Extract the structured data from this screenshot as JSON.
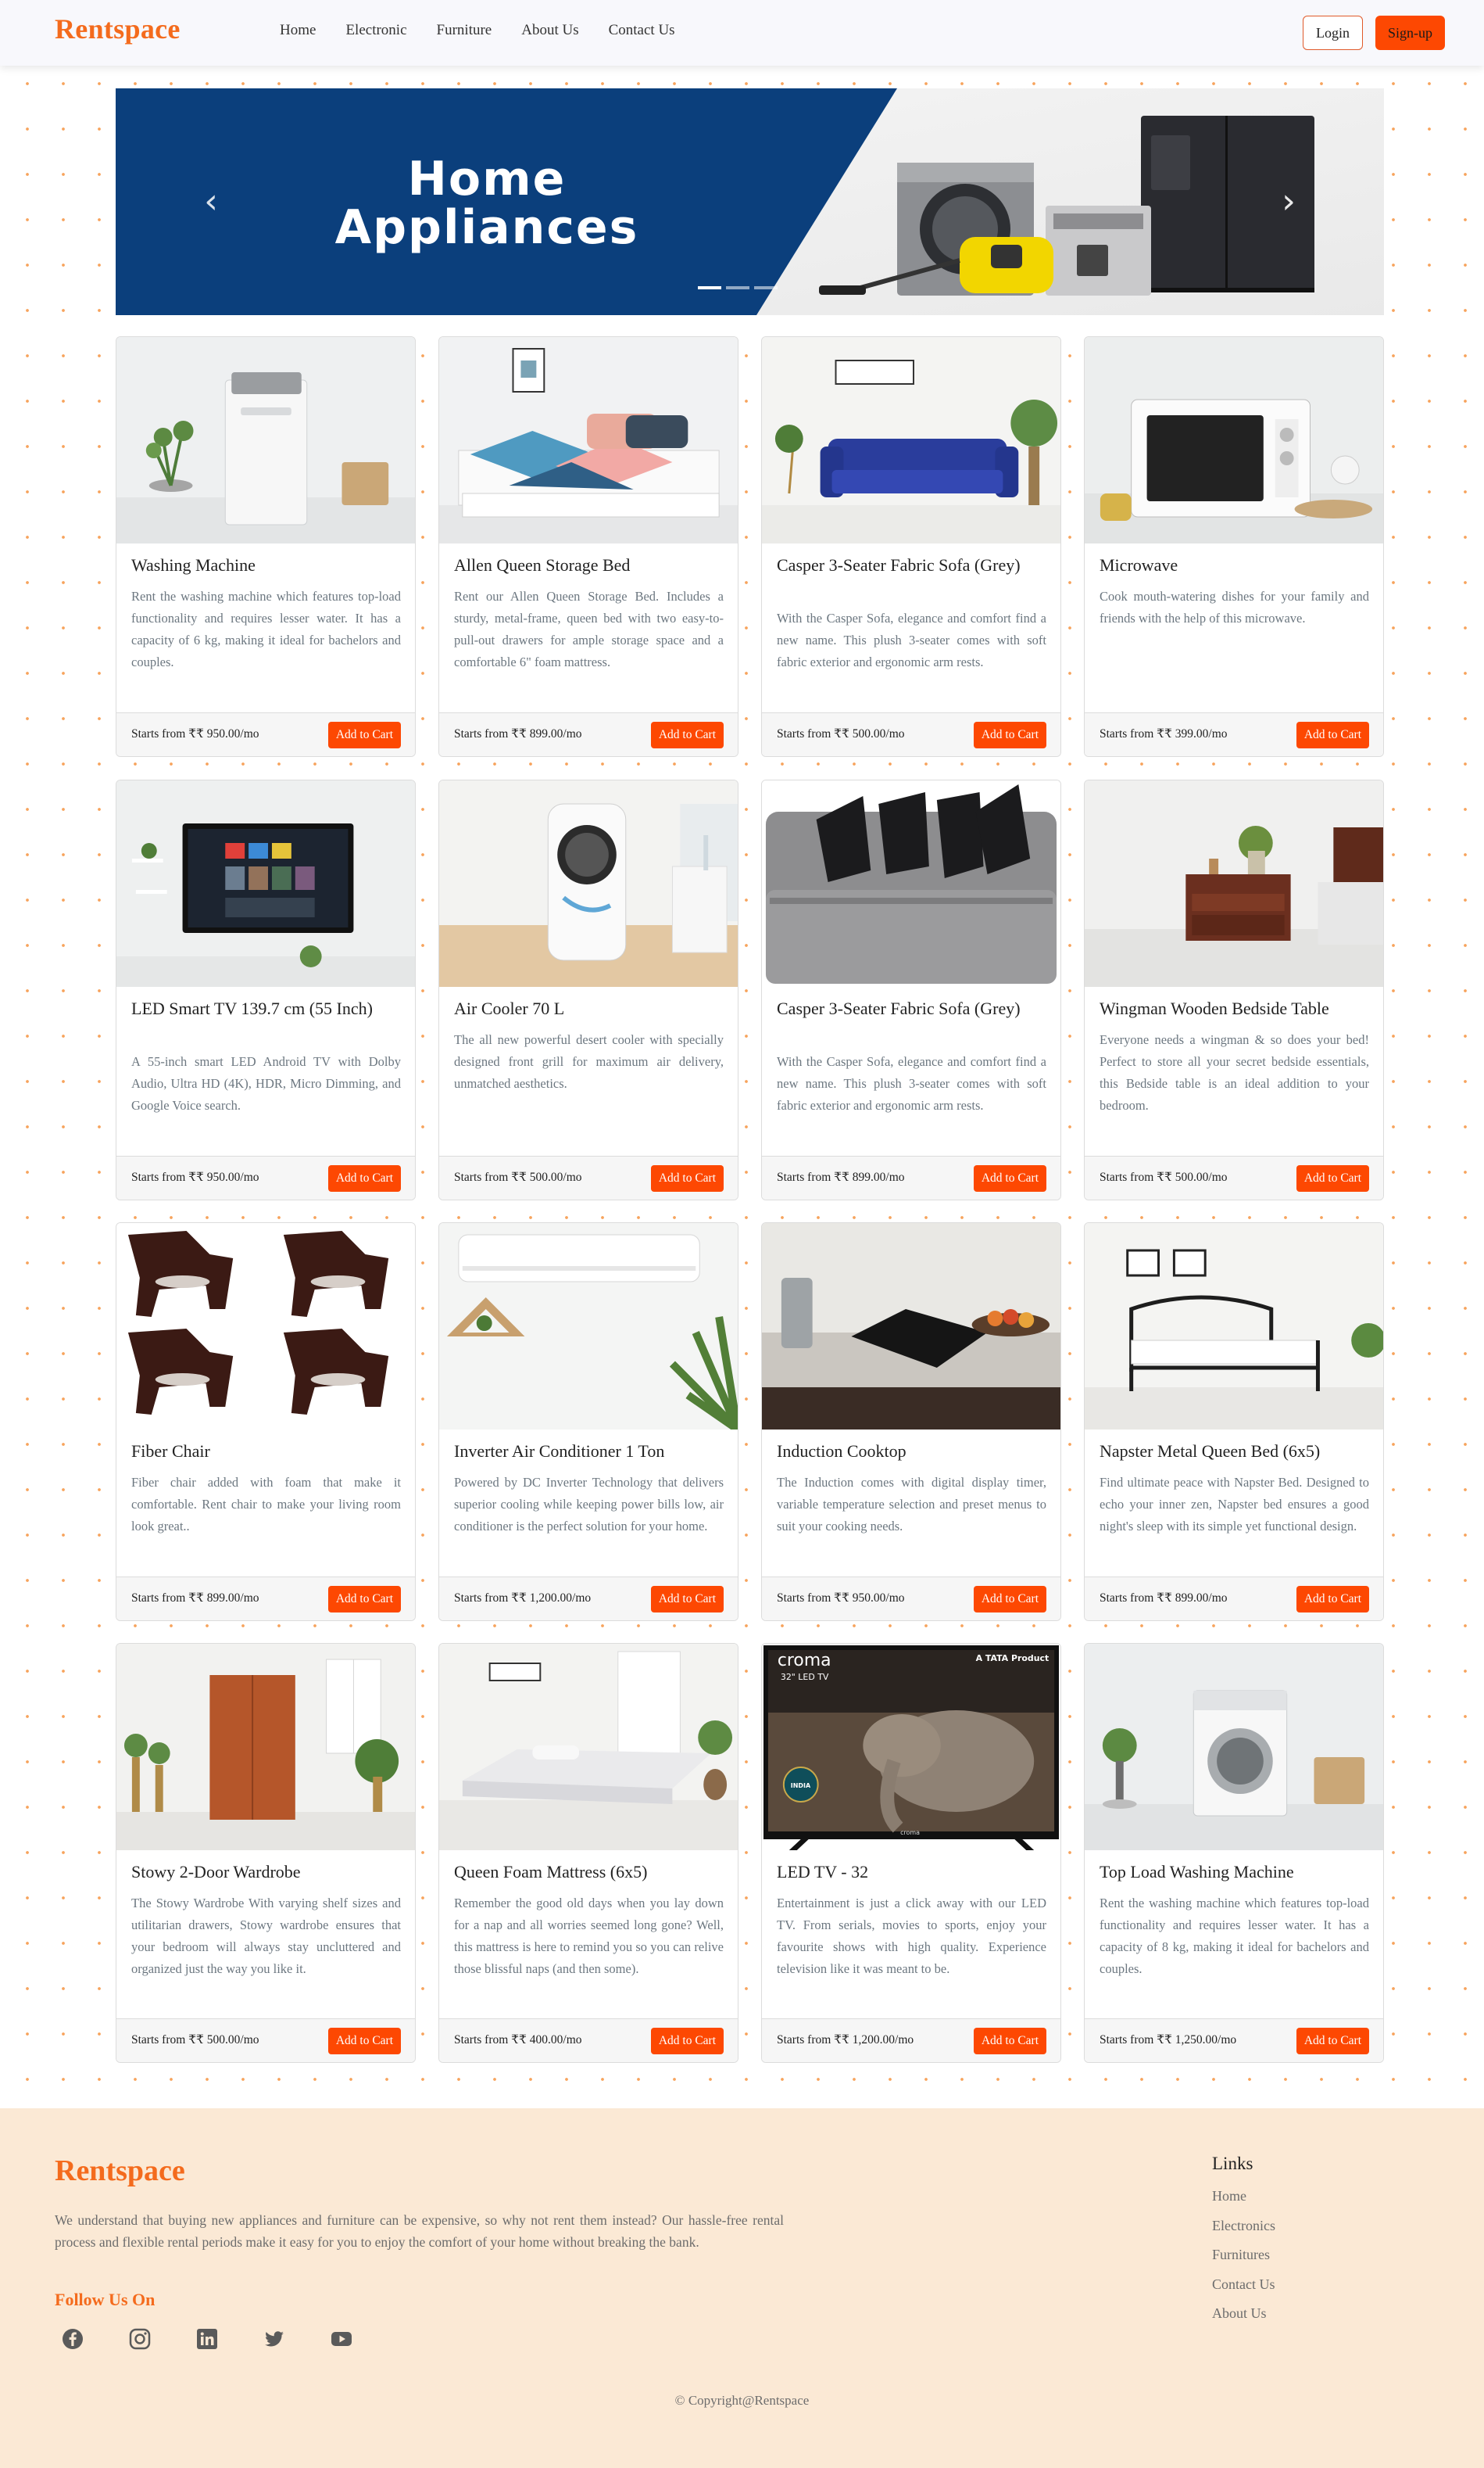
{
  "brand": "Rentspace",
  "nav": {
    "links": [
      "Home",
      "Electronic",
      "Furniture",
      "About Us",
      "Contact Us"
    ],
    "login": "Login",
    "signup": "Sign-up"
  },
  "carousel": {
    "title_line1": "Home",
    "title_line2": "Appliances",
    "prev": "‹",
    "next": "›",
    "slides": 3,
    "active_slide": 1
  },
  "products": [
    {
      "title": "Washing Machine",
      "desc": "Rent the washing machine which features top-load functionality and requires lesser water. It has a capacity of 6 kg, making it ideal for bachelors and couples.",
      "price": "Starts from ₹₹ 950.00/mo",
      "button": "Add to Cart",
      "image": "washing-machine"
    },
    {
      "title": "Allen Queen Storage Bed",
      "desc": "Rent our Allen Queen Storage Bed. Includes a sturdy, metal-frame, queen bed with two easy-to-pull-out drawers for ample storage space and a comfortable 6\" foam mattress.",
      "price": "Starts from ₹₹ 899.00/mo",
      "button": "Add to Cart",
      "image": "storage-bed"
    },
    {
      "title": "Casper 3-Seater Fabric Sofa (Grey)",
      "desc": "With the Casper Sofa, elegance and comfort find a new name. This plush 3-seater comes with soft fabric exterior and ergonomic arm rests.",
      "price": "Starts from ₹₹ 500.00/mo",
      "button": "Add to Cart",
      "image": "blue-sofa"
    },
    {
      "title": "Microwave",
      "desc": "Cook mouth-watering dishes for your family and friends with the help of this microwave.",
      "price": "Starts from ₹₹ 399.00/mo",
      "button": "Add to Cart",
      "image": "microwave"
    },
    {
      "title": "LED Smart TV 139.7 cm (55 Inch)",
      "desc": "A 55-inch smart LED Android TV with Dolby Audio, Ultra HD (4K), HDR, Micro Dimming, and Google Voice search.",
      "price": "Starts from ₹₹ 950.00/mo",
      "button": "Add to Cart",
      "image": "smart-tv"
    },
    {
      "title": "Air Cooler 70 L",
      "desc": "The all new powerful desert cooler with specially designed front grill for maximum air delivery, unmatched aesthetics.",
      "price": "Starts from ₹₹ 500.00/mo",
      "button": "Add to Cart",
      "image": "air-cooler"
    },
    {
      "title": "Casper 3-Seater Fabric Sofa (Grey)",
      "desc": "With the Casper Sofa, elegance and comfort find a new name. This plush 3-seater comes with soft fabric exterior and ergonomic arm rests.",
      "price": "Starts from ₹₹ 899.00/mo",
      "button": "Add to Cart",
      "image": "grey-sofa"
    },
    {
      "title": "Wingman Wooden Bedside Table",
      "desc": "Everyone needs a wingman & so does your bed! Perfect to store all your secret bedside essentials, this Bedside table is an ideal addition to your bedroom.",
      "price": "Starts from ₹₹ 500.00/mo",
      "button": "Add to Cart",
      "image": "bedside-table"
    },
    {
      "title": "Fiber Chair",
      "desc": "Fiber chair added with foam that make it comfortable. Rent chair to make your living room look great..",
      "price": "Starts from ₹₹ 899.00/mo",
      "button": "Add to Cart",
      "image": "fiber-chairs"
    },
    {
      "title": "Inverter Air Conditioner 1 Ton",
      "desc": "Powered by DC Inverter Technology that delivers superior cooling while keeping power bills low, air conditioner is the perfect solution for your home.",
      "price": "Starts from ₹₹ 1,200.00/mo",
      "button": "Add to Cart",
      "image": "air-conditioner"
    },
    {
      "title": "Induction Cooktop",
      "desc": "The Induction comes with digital display timer, variable temperature selection and preset menus to suit your cooking needs.",
      "price": "Starts from ₹₹ 950.00/mo",
      "button": "Add to Cart",
      "image": "induction-cooktop"
    },
    {
      "title": "Napster Metal Queen Bed (6x5)",
      "desc": "Find ultimate peace with Napster Bed. Designed to echo your inner zen, Napster bed ensures a good night's sleep with its simple yet functional design.",
      "price": "Starts from ₹₹ 899.00/mo",
      "button": "Add to Cart",
      "image": "metal-bed"
    },
    {
      "title": "Stowy 2-Door Wardrobe",
      "desc": "The Stowy Wardrobe With varying shelf sizes and utilitarian drawers, Stowy wardrobe ensures that your bedroom will always stay uncluttered and organized just the way you like it.",
      "price": "Starts from ₹₹ 500.00/mo",
      "button": "Add to Cart",
      "image": "wardrobe"
    },
    {
      "title": "Queen Foam Mattress (6x5)",
      "desc": "Remember the good old days when you lay down for a nap and all worries seemed long gone? Well, this mattress is here to remind you so you can relive those blissful naps (and then some).",
      "price": "Starts from ₹₹ 400.00/mo",
      "button": "Add to Cart",
      "image": "mattress"
    },
    {
      "title": "LED TV - 32",
      "desc": "Entertainment is just a click away with our LED TV. From serials, movies to sports, enjoy your favourite shows with high quality. Experience television like it was meant to be.",
      "price": "Starts from ₹₹ 1,200.00/mo",
      "button": "Add to Cart",
      "image": "led-tv",
      "image_text": {
        "brand": "croma",
        "sub": "32\" LED TV",
        "tag": "A TATA Product",
        "badge": "INDIA",
        "logo": "croma"
      }
    },
    {
      "title": "Top Load Washing Machine",
      "desc": "Rent the washing machine which features top-load functionality and requires lesser water. It has a capacity of 8 kg, making it ideal for bachelors and couples.",
      "price": "Starts from ₹₹ 1,250.00/mo",
      "button": "Add to Cart",
      "image": "front-load-washer"
    }
  ],
  "footer": {
    "brand": "Rentspace",
    "about": "We understand that buying new appliances and furniture can be expensive, so why not rent them instead? Our hassle-free rental process and flexible rental periods make it easy for you to enjoy the comfort of your home without breaking the bank.",
    "follow": "Follow Us On",
    "social": [
      "facebook-icon",
      "instagram-icon",
      "linkedin-icon",
      "twitter-icon",
      "youtube-icon"
    ],
    "links_title": "Links",
    "links": [
      "Home",
      "Electronics",
      "Furnitures",
      "Contact Us",
      "About Us"
    ],
    "copyright": "© Copyright@Rentspace"
  },
  "colors": {
    "brand": "#f46b1d",
    "button": "#fd4802",
    "footer_bg": "#fbe9d5",
    "banner_blue": "#0b3f7c"
  }
}
